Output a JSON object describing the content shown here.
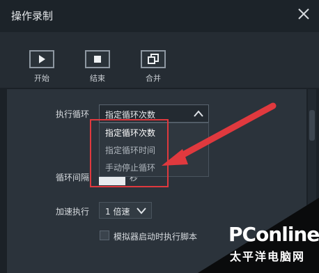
{
  "window": {
    "title": "操作录制"
  },
  "toolbar": {
    "start": "开始",
    "end": "结束",
    "merge": "合并"
  },
  "loop": {
    "label": "执行循环",
    "selected": "指定循环次数",
    "options": [
      "指定循环次数",
      "指定循环时间",
      "手动停止循环"
    ]
  },
  "interval": {
    "label": "循环间隔",
    "unit": "秒"
  },
  "speed": {
    "label": "加速执行",
    "selected": "1 倍速"
  },
  "autorun": {
    "label": "模拟器启动时执行脚本"
  },
  "watermark": {
    "brand": "PConline",
    "sub": "太平洋电脑网"
  },
  "colors": {
    "annotation": "#e0393e",
    "background": "#1b2127",
    "panel": "#2b333b"
  }
}
